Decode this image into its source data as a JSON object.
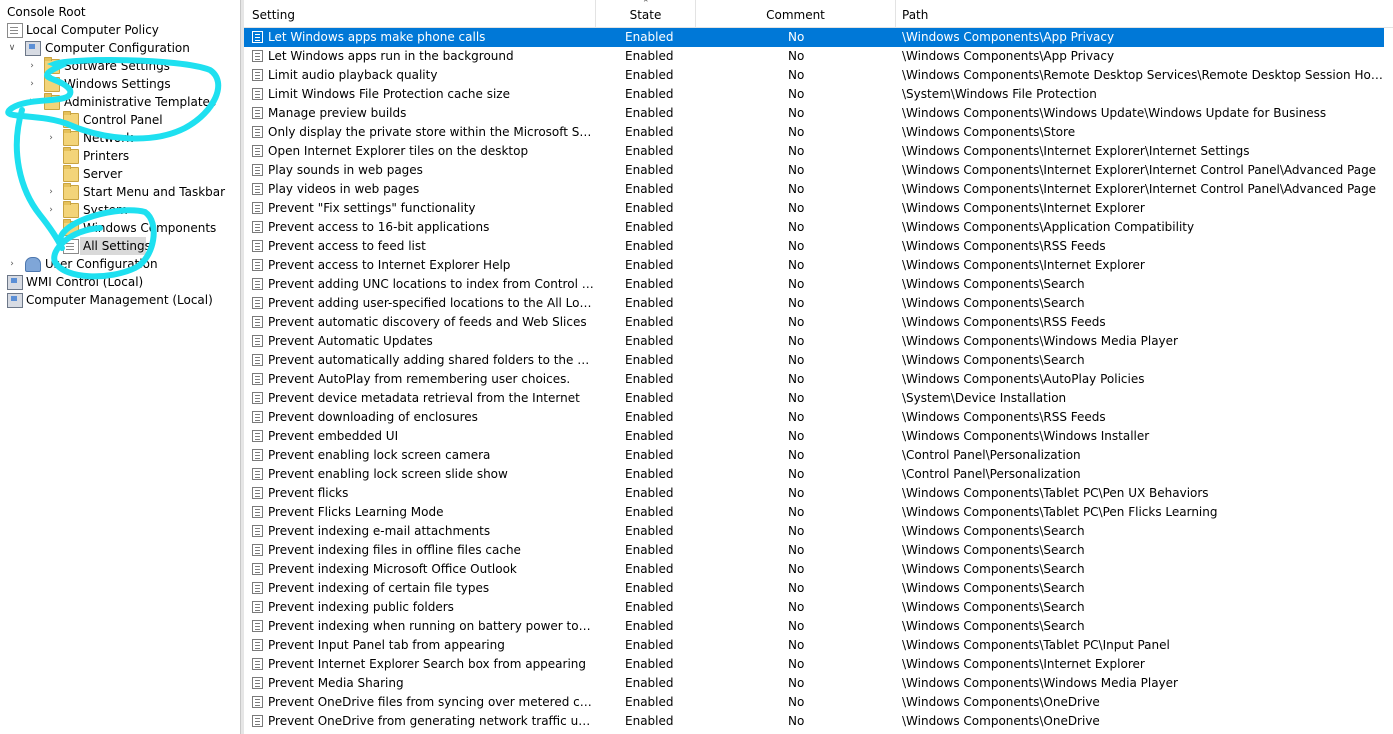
{
  "tree": {
    "console_root": "Console Root",
    "local_policy": "Local Computer Policy",
    "computer_config": "Computer Configuration",
    "software_settings": "Software Settings",
    "windows_settings": "Windows Settings",
    "admin_templates": "Administrative Templates",
    "control_panel": "Control Panel",
    "network": "Network",
    "printers": "Printers",
    "server": "Server",
    "start_menu": "Start Menu and Taskbar",
    "system": "System",
    "windows_components": "Windows Components",
    "all_settings": "All Settings",
    "user_config": "User Configuration",
    "wmi_control": "WMI Control (Local)",
    "computer_mgmt": "Computer Management (Local)"
  },
  "annotation_color": "#1ee0f0",
  "selection_color": "#0078d7",
  "columns": {
    "setting": "Setting",
    "state": "State",
    "comment": "Comment",
    "path": "Path"
  },
  "rows": [
    {
      "setting": "Let Windows apps make phone calls",
      "state": "Enabled",
      "comment": "No",
      "path": "\\Windows Components\\App Privacy"
    },
    {
      "setting": "Let Windows apps run in the background",
      "state": "Enabled",
      "comment": "No",
      "path": "\\Windows Components\\App Privacy"
    },
    {
      "setting": "Limit audio playback quality",
      "state": "Enabled",
      "comment": "No",
      "path": "\\Windows Components\\Remote Desktop Services\\Remote Desktop Session Host\\Device ..."
    },
    {
      "setting": "Limit Windows File Protection cache size",
      "state": "Enabled",
      "comment": "No",
      "path": "\\System\\Windows File Protection"
    },
    {
      "setting": "Manage preview builds",
      "state": "Enabled",
      "comment": "No",
      "path": "\\Windows Components\\Windows Update\\Windows Update for Business"
    },
    {
      "setting": "Only display the private store within the Microsoft Store",
      "state": "Enabled",
      "comment": "No",
      "path": "\\Windows Components\\Store"
    },
    {
      "setting": "Open Internet Explorer tiles on the desktop",
      "state": "Enabled",
      "comment": "No",
      "path": "\\Windows Components\\Internet Explorer\\Internet Settings"
    },
    {
      "setting": "Play sounds in web pages",
      "state": "Enabled",
      "comment": "No",
      "path": "\\Windows Components\\Internet Explorer\\Internet Control Panel\\Advanced Page"
    },
    {
      "setting": "Play videos in web pages",
      "state": "Enabled",
      "comment": "No",
      "path": "\\Windows Components\\Internet Explorer\\Internet Control Panel\\Advanced Page"
    },
    {
      "setting": "Prevent \"Fix settings\" functionality",
      "state": "Enabled",
      "comment": "No",
      "path": "\\Windows Components\\Internet Explorer"
    },
    {
      "setting": "Prevent access to 16-bit applications",
      "state": "Enabled",
      "comment": "No",
      "path": "\\Windows Components\\Application Compatibility"
    },
    {
      "setting": "Prevent access to feed list",
      "state": "Enabled",
      "comment": "No",
      "path": "\\Windows Components\\RSS Feeds"
    },
    {
      "setting": "Prevent access to Internet Explorer Help",
      "state": "Enabled",
      "comment": "No",
      "path": "\\Windows Components\\Internet Explorer"
    },
    {
      "setting": "Prevent adding UNC locations to index from Control Panel",
      "state": "Enabled",
      "comment": "No",
      "path": "\\Windows Components\\Search"
    },
    {
      "setting": "Prevent adding user-specified locations to the All Locations ...",
      "state": "Enabled",
      "comment": "No",
      "path": "\\Windows Components\\Search"
    },
    {
      "setting": "Prevent automatic discovery of feeds and Web Slices",
      "state": "Enabled",
      "comment": "No",
      "path": "\\Windows Components\\RSS Feeds"
    },
    {
      "setting": "Prevent Automatic Updates",
      "state": "Enabled",
      "comment": "No",
      "path": "\\Windows Components\\Windows Media Player"
    },
    {
      "setting": "Prevent automatically adding shared folders to the Window...",
      "state": "Enabled",
      "comment": "No",
      "path": "\\Windows Components\\Search"
    },
    {
      "setting": "Prevent AutoPlay from remembering user choices.",
      "state": "Enabled",
      "comment": "No",
      "path": "\\Windows Components\\AutoPlay Policies"
    },
    {
      "setting": "Prevent device metadata retrieval from the Internet",
      "state": "Enabled",
      "comment": "No",
      "path": "\\System\\Device Installation"
    },
    {
      "setting": "Prevent downloading of enclosures",
      "state": "Enabled",
      "comment": "No",
      "path": "\\Windows Components\\RSS Feeds"
    },
    {
      "setting": "Prevent embedded UI",
      "state": "Enabled",
      "comment": "No",
      "path": "\\Windows Components\\Windows Installer"
    },
    {
      "setting": "Prevent enabling lock screen camera",
      "state": "Enabled",
      "comment": "No",
      "path": "\\Control Panel\\Personalization"
    },
    {
      "setting": "Prevent enabling lock screen slide show",
      "state": "Enabled",
      "comment": "No",
      "path": "\\Control Panel\\Personalization"
    },
    {
      "setting": "Prevent flicks",
      "state": "Enabled",
      "comment": "No",
      "path": "\\Windows Components\\Tablet PC\\Pen UX Behaviors"
    },
    {
      "setting": "Prevent Flicks Learning Mode",
      "state": "Enabled",
      "comment": "No",
      "path": "\\Windows Components\\Tablet PC\\Pen Flicks Learning"
    },
    {
      "setting": "Prevent indexing e-mail attachments",
      "state": "Enabled",
      "comment": "No",
      "path": "\\Windows Components\\Search"
    },
    {
      "setting": "Prevent indexing files in offline files cache",
      "state": "Enabled",
      "comment": "No",
      "path": "\\Windows Components\\Search"
    },
    {
      "setting": "Prevent indexing Microsoft Office Outlook",
      "state": "Enabled",
      "comment": "No",
      "path": "\\Windows Components\\Search"
    },
    {
      "setting": "Prevent indexing of certain file types",
      "state": "Enabled",
      "comment": "No",
      "path": "\\Windows Components\\Search"
    },
    {
      "setting": "Prevent indexing public folders",
      "state": "Enabled",
      "comment": "No",
      "path": "\\Windows Components\\Search"
    },
    {
      "setting": "Prevent indexing when running on battery power to conserv...",
      "state": "Enabled",
      "comment": "No",
      "path": "\\Windows Components\\Search"
    },
    {
      "setting": "Prevent Input Panel tab from appearing",
      "state": "Enabled",
      "comment": "No",
      "path": "\\Windows Components\\Tablet PC\\Input Panel"
    },
    {
      "setting": "Prevent Internet Explorer Search box from appearing",
      "state": "Enabled",
      "comment": "No",
      "path": "\\Windows Components\\Internet Explorer"
    },
    {
      "setting": "Prevent Media Sharing",
      "state": "Enabled",
      "comment": "No",
      "path": "\\Windows Components\\Windows Media Player"
    },
    {
      "setting": "Prevent OneDrive files from syncing over metered connecti...",
      "state": "Enabled",
      "comment": "No",
      "path": "\\Windows Components\\OneDrive"
    },
    {
      "setting": "Prevent OneDrive from generating network traffic until the ...",
      "state": "Enabled",
      "comment": "No",
      "path": "\\Windows Components\\OneDrive"
    }
  ]
}
